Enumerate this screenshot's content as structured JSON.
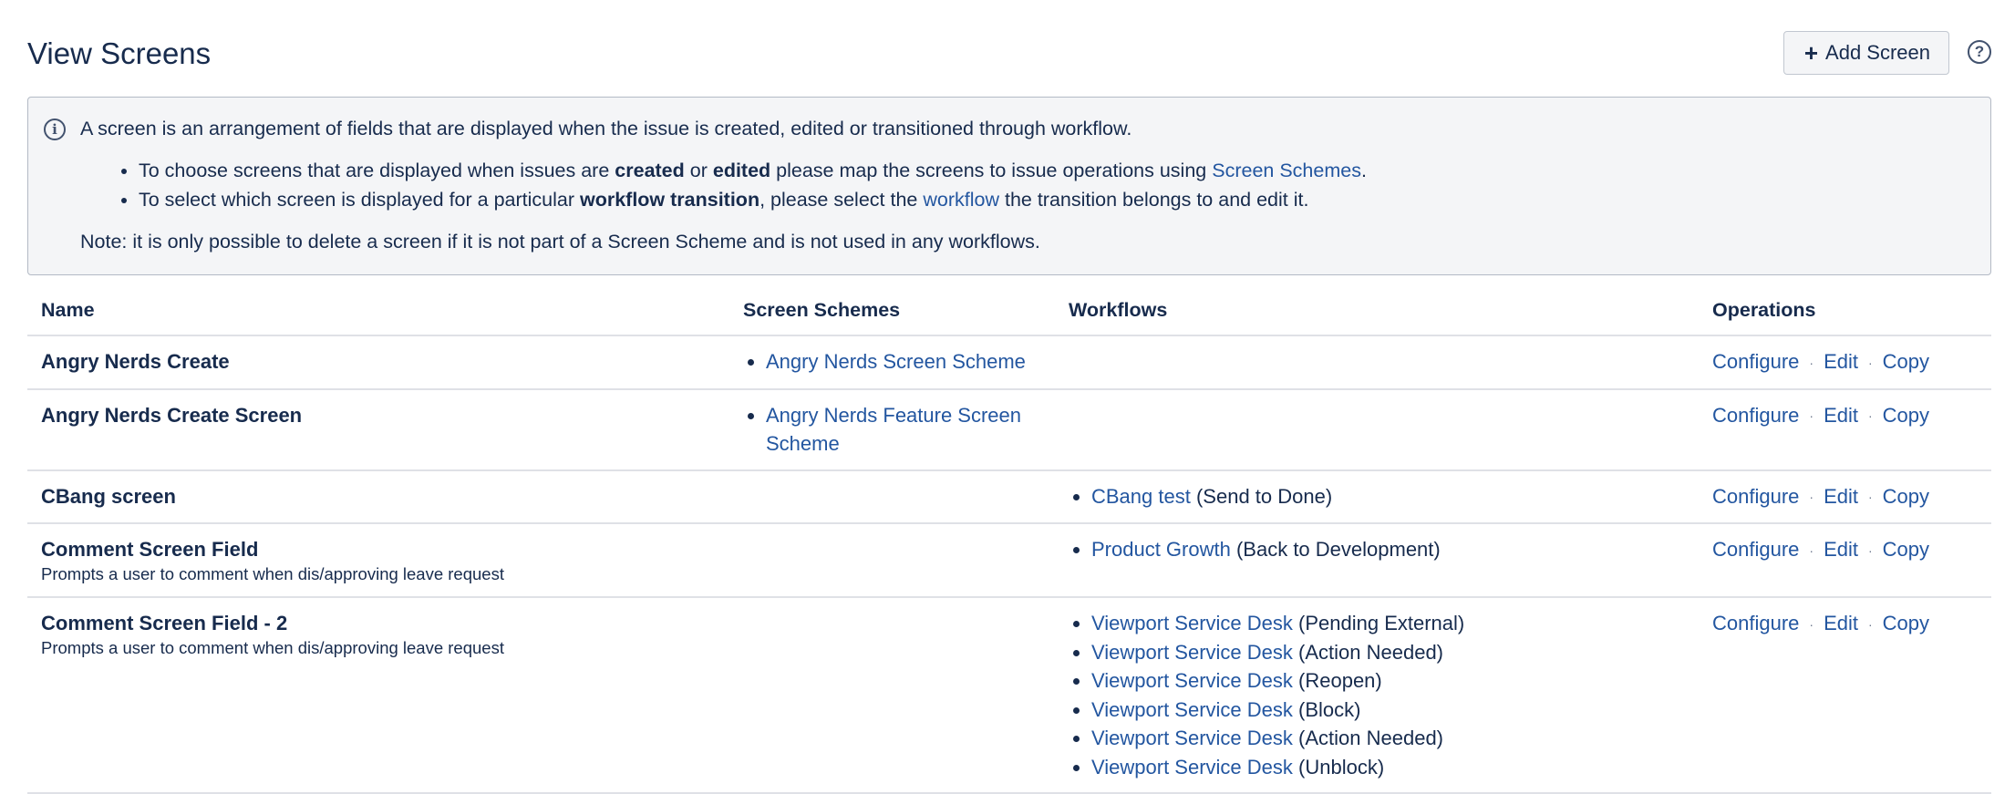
{
  "header": {
    "title": "View Screens",
    "add_button_label": "Add Screen",
    "add_button_icon": "plus-icon",
    "help_icon": "help-icon",
    "help_glyph": "?"
  },
  "info": {
    "icon": "info-icon",
    "intro": "A screen is an arrangement of fields that are displayed when the issue is created, edited or transitioned through workflow.",
    "bullet1": {
      "pre": "To choose screens that are displayed when issues are ",
      "bold1": "created",
      "mid1": " or ",
      "bold2": "edited",
      "mid2": " please map the screens to issue operations using ",
      "link": "Screen Schemes",
      "post": "."
    },
    "bullet2": {
      "pre": "To select which screen is displayed for a particular ",
      "bold": "workflow transition",
      "mid": ", please select the ",
      "link": "workflow",
      "post": " the transition belongs to and edit it."
    },
    "note": "Note: it is only possible to delete a screen if it is not part of a Screen Scheme and is not used in any workflows."
  },
  "table": {
    "headers": {
      "name": "Name",
      "schemes": "Screen Schemes",
      "workflows": "Workflows",
      "operations": "Operations"
    },
    "operations": {
      "configure": "Configure",
      "edit": "Edit",
      "copy": "Copy",
      "separator": "·"
    },
    "rows": [
      {
        "name": "Angry Nerds Create",
        "desc": "",
        "schemes": [
          "Angry Nerds Screen Scheme"
        ],
        "workflows": []
      },
      {
        "name": "Angry Nerds Create Screen",
        "desc": "",
        "schemes": [
          "Angry Nerds Feature Screen Scheme"
        ],
        "workflows": []
      },
      {
        "name": "CBang screen",
        "desc": "",
        "schemes": [],
        "workflows": [
          {
            "link": "CBang test",
            "transition": "(Send to Done)"
          }
        ]
      },
      {
        "name": "Comment Screen Field",
        "desc": "Prompts a user to comment when dis/approving leave request",
        "schemes": [],
        "workflows": [
          {
            "link": "Product Growth",
            "transition": "(Back to Development)"
          }
        ]
      },
      {
        "name": "Comment Screen Field - 2",
        "desc": "Prompts a user to comment when dis/approving leave request",
        "schemes": [],
        "workflows": [
          {
            "link": "Viewport Service Desk",
            "transition": "(Pending External)"
          },
          {
            "link": "Viewport Service Desk",
            "transition": "(Action Needed)"
          },
          {
            "link": "Viewport Service Desk",
            "transition": "(Reopen)"
          },
          {
            "link": "Viewport Service Desk",
            "transition": "(Block)"
          },
          {
            "link": "Viewport Service Desk",
            "transition": "(Action Needed)"
          },
          {
            "link": "Viewport Service Desk",
            "transition": "(Unblock)"
          }
        ]
      }
    ]
  },
  "colors": {
    "link": "#2356a0",
    "text": "#172b4d",
    "panel_bg": "#f4f5f7",
    "border": "#dfe1e6"
  }
}
